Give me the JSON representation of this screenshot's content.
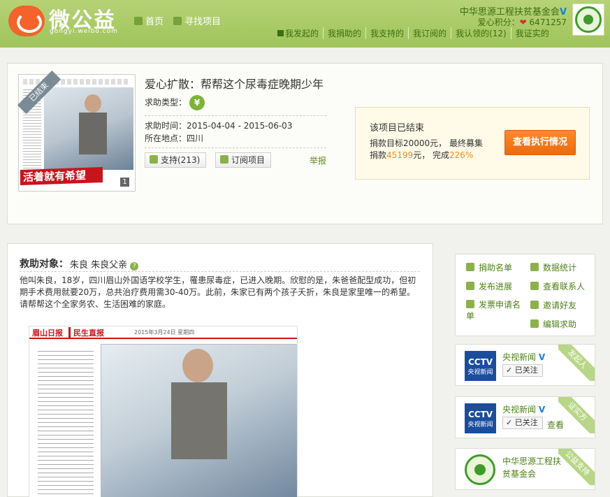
{
  "header": {
    "logo_text": "微公益",
    "logo_sub": "gongyi.weibo.com",
    "nav": [
      "首页",
      "寻找项目"
    ],
    "org_name": "中华思源工程扶贫基金会",
    "points_label": "爱心积分：",
    "points_value": "6471257",
    "subnav": [
      "我发起的",
      "我捐助的",
      "我支持的",
      "我订阅的",
      "我认领的(12)",
      "我证实的"
    ]
  },
  "project": {
    "thumb_tag": "已结束",
    "thumb_banner": "活着就有希望",
    "thumb_page": "1",
    "title": "爱心扩散：帮帮这个尿毒症晚期少年",
    "type_label": "求助类型：",
    "type_icon": "¥",
    "date_label": "求助时间：",
    "date_value": "2015-04-04 - 2015-06-03",
    "location_label": "所在地点：",
    "location_value": "四川",
    "support_btn": "支持(213)",
    "subscribe_btn": "订阅项目",
    "report": "举报",
    "status_title": "该项目已结束",
    "goal_text": "捐款目标20000元，  最终募集",
    "raised_prefix": "捐款",
    "raised_amount": "45199",
    "raised_unit": "元，  完成",
    "raised_percent": "226%",
    "exec_btn": "查看执行情况"
  },
  "rescue": {
    "heading": "救助对象：",
    "names": "朱良 朱良父亲",
    "qm": "?",
    "description": "他叫朱良，18岁，四川眉山外国语学校学生，罹患尿毒症，已进入晚期。欣慰的是，朱爸爸配型成功，但初期手术费用就要20万，总共治疗费用需30-40万。此前，朱家已有两个孩子夭折，朱良是家里唯一的希望。请帮帮这个全家务农、生活困难的家庭。",
    "news_logo": "眉山日报",
    "news_section": "民生直报",
    "news_date": "2015年3月24日  星期四"
  },
  "sidebar": {
    "links": [
      "捐助名单",
      "数据统计",
      "发布进展",
      "查看联系人",
      "发票申请名单",
      "邀请好友",
      "编辑求助"
    ],
    "cards": [
      {
        "logo_top": "CCTV",
        "logo_bottom": "央视新闻",
        "name": "央视新闻",
        "follow": "已关注",
        "tag": "发起人"
      },
      {
        "logo_top": "CCTV",
        "logo_bottom": "央视新闻",
        "name": "央视新闻",
        "follow": "已关注",
        "view": "查看",
        "tag": "证实方"
      },
      {
        "name": "中华思源工程扶贫基金会",
        "tag": "公益支持"
      }
    ]
  },
  "colors": {
    "header_green": "#9fc45a",
    "accent_orange": "#f08a1c",
    "button_orange": "#ec6a10",
    "link_green": "#4d7f17"
  }
}
